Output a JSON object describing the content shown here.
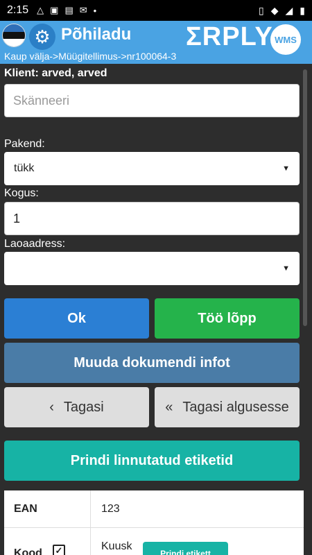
{
  "status_bar": {
    "time": "2:15",
    "icons": [
      "alert-triangle-icon",
      "image-icon",
      "news-icon",
      "gmail-icon",
      "dot-icon"
    ],
    "right_icons": [
      "vibrate-icon",
      "wifi-icon",
      "signal-icon",
      "battery-icon"
    ]
  },
  "app_bar": {
    "title": "Põhiladu",
    "logo_text": "ΣRPLY",
    "badge": "WMS",
    "breadcrumb": "Kaup välja->Müügitellimus->nr100064-3",
    "accent_color": "#4aa3e3"
  },
  "form": {
    "client_label": "Klient: arved, arved",
    "scan_placeholder": "Skänneeri",
    "scan_value": "",
    "package_label": "Pakend:",
    "package_value": "tükk",
    "quantity_label": "Kogus:",
    "quantity_value": "1",
    "location_label": "Laoaadress:",
    "location_value": ""
  },
  "buttons": {
    "ok": "Ok",
    "done": "Töö lõpp",
    "edit_doc": "Muuda dokumendi infot",
    "back": "Tagasi",
    "back_to_start": "Tagasi algusesse",
    "print_checked": "Prindi linnutatud etiketid"
  },
  "table": {
    "rows": [
      {
        "key": "EAN",
        "value": "123"
      },
      {
        "key": "Kood",
        "value": "Kuusk",
        "checked": true,
        "action": "Prindi etikett"
      }
    ]
  }
}
